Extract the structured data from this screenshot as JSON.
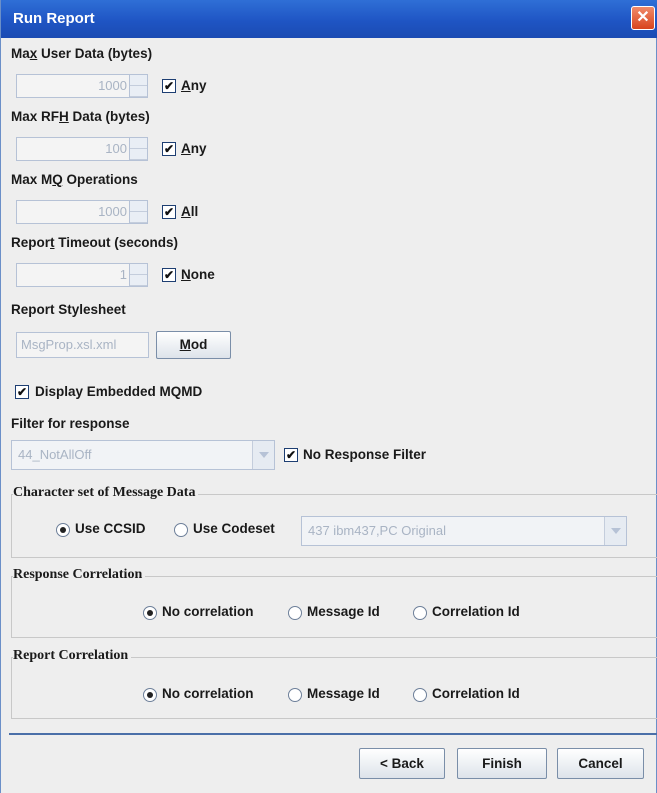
{
  "window": {
    "title": "Run Report",
    "close_glyph": "✕"
  },
  "max_user_data": {
    "label_pre": "Ma",
    "label_mn": "x",
    "label_post": " User Data (bytes)",
    "value": "1000",
    "check_pre": "",
    "check_mn": "A",
    "check_post": "ny",
    "checked": true
  },
  "max_rfh_data": {
    "label_pre": "Max RF",
    "label_mn": "H",
    "label_post": " Data (bytes)",
    "value": "100",
    "check_pre": "",
    "check_mn": "A",
    "check_post": "ny",
    "checked": true
  },
  "max_mq_ops": {
    "label_pre": "Max M",
    "label_mn": "Q",
    "label_post": " Operations",
    "value": "1000",
    "check_pre": "",
    "check_mn": "A",
    "check_post": "ll",
    "checked": true
  },
  "report_timeout": {
    "label_pre": "Repor",
    "label_mn": "t",
    "label_post": " Timeout (seconds)",
    "value": "1",
    "check_pre": "",
    "check_mn": "N",
    "check_post": "one",
    "checked": true
  },
  "stylesheet": {
    "label": "Report Stylesheet",
    "value": "MsgProp.xsl.xml",
    "button_mn": "M",
    "button_post": "od"
  },
  "embedded_mqmd": {
    "label_pre": "Display Embedded MQMD",
    "checked": true
  },
  "filter": {
    "label": "Filter for response",
    "value": "44_NotAllOff",
    "no_filter_label": "No Response Filter",
    "checked": true
  },
  "charset_group": {
    "title": "Character set of Message Data",
    "use_ccsid": "Use CCSID",
    "use_codeset": "Use Codeset",
    "codeset_value": "437   ibm437,PC Original",
    "selected": "use_ccsid"
  },
  "response_correlation": {
    "title": "Response Correlation",
    "options": [
      "No correlation",
      "Message Id",
      "Correlation Id"
    ],
    "selected": 0
  },
  "report_correlation": {
    "title": "Report Correlation",
    "options": [
      "No correlation",
      "Message Id",
      "Correlation Id"
    ],
    "selected": 0
  },
  "buttons": {
    "back": "< Back",
    "finish": "Finish",
    "cancel": "Cancel"
  },
  "colors": {
    "titlebar": "#2f6fd6",
    "panel": "#eeeeee",
    "disabled_text": "#a9b4c4"
  },
  "check_glyph": "✔"
}
